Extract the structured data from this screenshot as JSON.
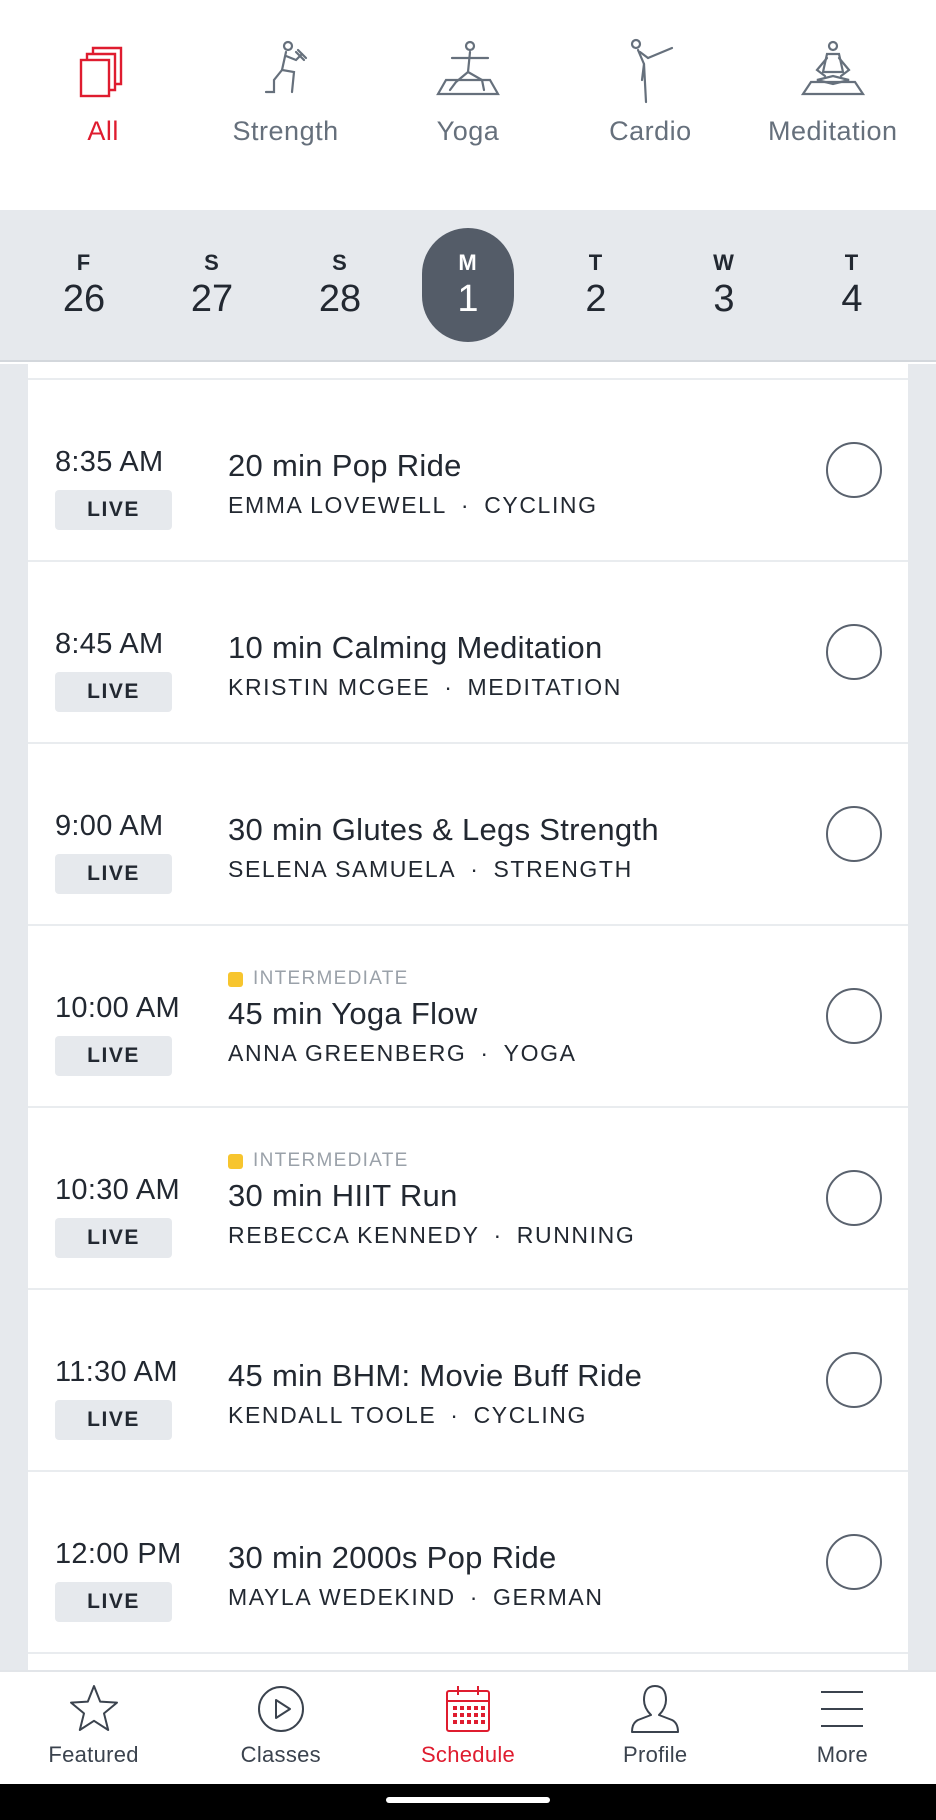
{
  "colors": {
    "accent": "#df1c2f",
    "selected_day": "#545c68",
    "intermediate": "#f7c52e"
  },
  "categories": [
    {
      "label": "All",
      "icon": "stacked-squares-icon",
      "active": true
    },
    {
      "label": "Strength",
      "icon": "strength-icon",
      "active": false
    },
    {
      "label": "Yoga",
      "icon": "yoga-icon",
      "active": false
    },
    {
      "label": "Cardio",
      "icon": "cardio-icon",
      "active": false
    },
    {
      "label": "Meditation",
      "icon": "meditation-icon",
      "active": false
    }
  ],
  "days": [
    {
      "letter": "F",
      "num": "26"
    },
    {
      "letter": "S",
      "num": "27"
    },
    {
      "letter": "S",
      "num": "28"
    },
    {
      "letter": "M",
      "num": "1",
      "selected": true
    },
    {
      "letter": "T",
      "num": "2"
    },
    {
      "letter": "W",
      "num": "3"
    },
    {
      "letter": "T",
      "num": "4"
    }
  ],
  "classes": [
    {
      "time": "8:35 AM",
      "badge": "LIVE",
      "level": "",
      "title": "20 min Pop Ride",
      "instructor": "EMMA LOVEWELL",
      "separator": "·",
      "category": "CYCLING"
    },
    {
      "time": "8:45 AM",
      "badge": "LIVE",
      "level": "",
      "title": "10 min Calming Meditation",
      "instructor": "KRISTIN MCGEE",
      "separator": "·",
      "category": "MEDITATION"
    },
    {
      "time": "9:00 AM",
      "badge": "LIVE",
      "level": "",
      "title": "30 min Glutes & Legs Strength",
      "instructor": "SELENA SAMUELA",
      "separator": "·",
      "category": "STRENGTH"
    },
    {
      "time": "10:00 AM",
      "badge": "LIVE",
      "level": "INTERMEDIATE",
      "title": "45 min Yoga Flow",
      "instructor": "ANNA GREENBERG",
      "separator": "·",
      "category": "YOGA"
    },
    {
      "time": "10:30 AM",
      "badge": "LIVE",
      "level": "INTERMEDIATE",
      "title": "30 min HIIT Run",
      "instructor": "REBECCA KENNEDY",
      "separator": "·",
      "category": "RUNNING"
    },
    {
      "time": "11:30 AM",
      "badge": "LIVE",
      "level": "",
      "title": "45 min BHM: Movie Buff Ride",
      "instructor": "KENDALL TOOLE",
      "separator": "·",
      "category": "CYCLING"
    },
    {
      "time": "12:00 PM",
      "badge": "LIVE",
      "level": "",
      "title": "30 min 2000s Pop Ride",
      "instructor": "MAYLA WEDEKIND",
      "separator": "·",
      "category": "GERMAN"
    }
  ],
  "nav": [
    {
      "label": "Featured",
      "icon": "star-icon"
    },
    {
      "label": "Classes",
      "icon": "play-circle-icon"
    },
    {
      "label": "Schedule",
      "icon": "calendar-icon",
      "active": true
    },
    {
      "label": "Profile",
      "icon": "person-icon"
    },
    {
      "label": "More",
      "icon": "menu-icon"
    }
  ]
}
